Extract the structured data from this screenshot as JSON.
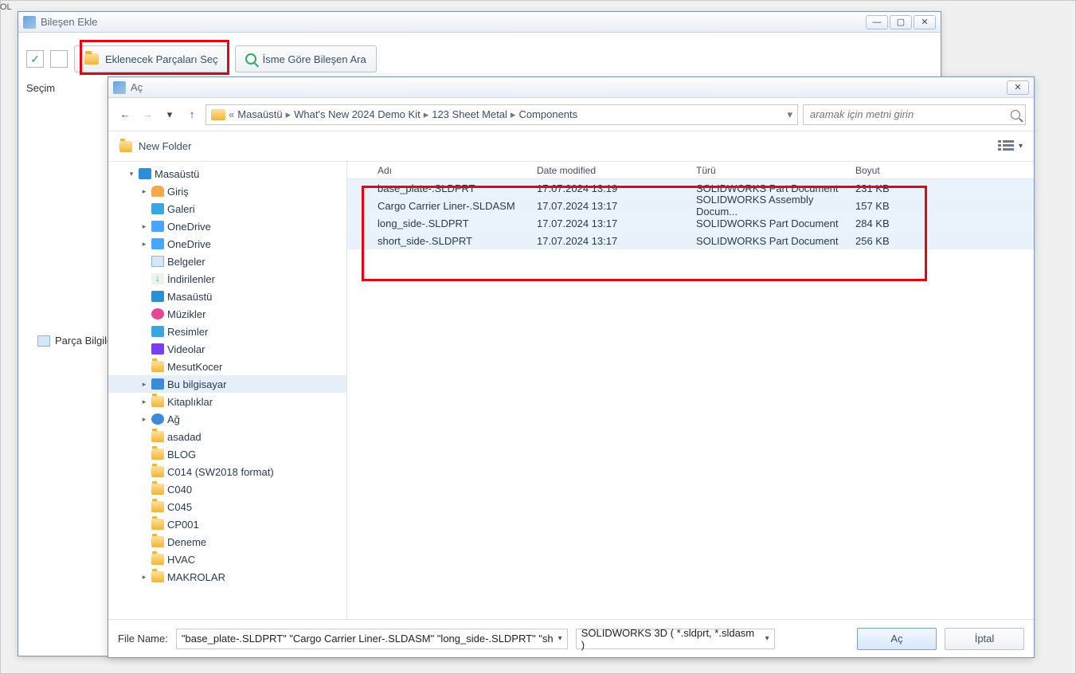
{
  "tag_ol": "OL",
  "bilesenekle": {
    "title": "Bileşen Ekle",
    "btn_select_parts": "Eklenecek Parçaları Seç",
    "btn_search_by_name": "İsme Göre Bileşen Ara",
    "secim_label": "Seçim",
    "parca_label": "Parça Bilgile"
  },
  "open": {
    "title": "Aç",
    "new_folder": "New Folder",
    "search_placeholder": "aramak için metni girin",
    "breadcrumb": [
      "Masaüstü",
      "What's New 2024 Demo Kit",
      "123 Sheet Metal",
      "Components"
    ],
    "bc_prefix": "«",
    "tree": [
      {
        "ico": "desktop",
        "label": "Masaüstü",
        "indent": 0,
        "tri": "▾"
      },
      {
        "ico": "home",
        "label": "Giriş",
        "indent": 1,
        "tri": "▸"
      },
      {
        "ico": "pic",
        "label": "Galeri",
        "indent": 1,
        "tri": ""
      },
      {
        "ico": "drive",
        "label": "OneDrive",
        "indent": 1,
        "tri": "▸"
      },
      {
        "ico": "drive",
        "label": "OneDrive",
        "indent": 1,
        "tri": "▸"
      },
      {
        "ico": "doc",
        "label": "Belgeler",
        "indent": 1,
        "tri": ""
      },
      {
        "ico": "down",
        "label": "İndirilenler",
        "indent": 1,
        "tri": ""
      },
      {
        "ico": "desktop",
        "label": "Masaüstü",
        "indent": 1,
        "tri": ""
      },
      {
        "ico": "music",
        "label": "Müzikler",
        "indent": 1,
        "tri": ""
      },
      {
        "ico": "pic",
        "label": "Resimler",
        "indent": 1,
        "tri": ""
      },
      {
        "ico": "video",
        "label": "Videolar",
        "indent": 1,
        "tri": ""
      },
      {
        "ico": "folder",
        "label": "MesutKocer",
        "indent": 1,
        "tri": ""
      },
      {
        "ico": "this-pc",
        "label": "Bu bilgisayar",
        "indent": 1,
        "tri": "▸",
        "sel": true
      },
      {
        "ico": "folder",
        "label": "Kitaplıklar",
        "indent": 1,
        "tri": "▸"
      },
      {
        "ico": "net",
        "label": "Ağ",
        "indent": 1,
        "tri": "▸"
      },
      {
        "ico": "folder",
        "label": "asadad",
        "indent": 1,
        "tri": ""
      },
      {
        "ico": "folder",
        "label": "BLOG",
        "indent": 1,
        "tri": ""
      },
      {
        "ico": "folder",
        "label": "C014 (SW2018 format)",
        "indent": 1,
        "tri": ""
      },
      {
        "ico": "folder",
        "label": "C040",
        "indent": 1,
        "tri": ""
      },
      {
        "ico": "folder",
        "label": "C045",
        "indent": 1,
        "tri": ""
      },
      {
        "ico": "folder",
        "label": "CP001",
        "indent": 1,
        "tri": ""
      },
      {
        "ico": "folder",
        "label": "Deneme",
        "indent": 1,
        "tri": ""
      },
      {
        "ico": "folder",
        "label": "HVAC",
        "indent": 1,
        "tri": ""
      },
      {
        "ico": "folder",
        "label": "MAKROLAR",
        "indent": 1,
        "tri": "▸"
      }
    ],
    "cols": {
      "name": "Adı",
      "date": "Date modified",
      "type": "Türü",
      "size": "Boyut"
    },
    "files": [
      {
        "name": "base_plate-.SLDPRT",
        "date": "17.07.2024 13:19",
        "type": "SOLIDWORKS Part Document",
        "size": "231 KB"
      },
      {
        "name": "Cargo Carrier Liner-.SLDASM",
        "date": "17.07.2024 13:17",
        "type": "SOLIDWORKS Assembly Docum...",
        "size": "157 KB"
      },
      {
        "name": "long_side-.SLDPRT",
        "date": "17.07.2024 13:17",
        "type": "SOLIDWORKS Part Document",
        "size": "284 KB"
      },
      {
        "name": "short_side-.SLDPRT",
        "date": "17.07.2024 13:17",
        "type": "SOLIDWORKS Part Document",
        "size": "256 KB"
      }
    ],
    "file_name_label": "File Name:",
    "file_name_value": "\"base_plate-.SLDPRT\" \"Cargo Carrier Liner-.SLDASM\" \"long_side-.SLDPRT\" \"sh",
    "filter_value": "SOLIDWORKS 3D  ( *.sldprt,  *.sldasm )",
    "btn_open": "Aç",
    "btn_cancel": "İptal"
  }
}
